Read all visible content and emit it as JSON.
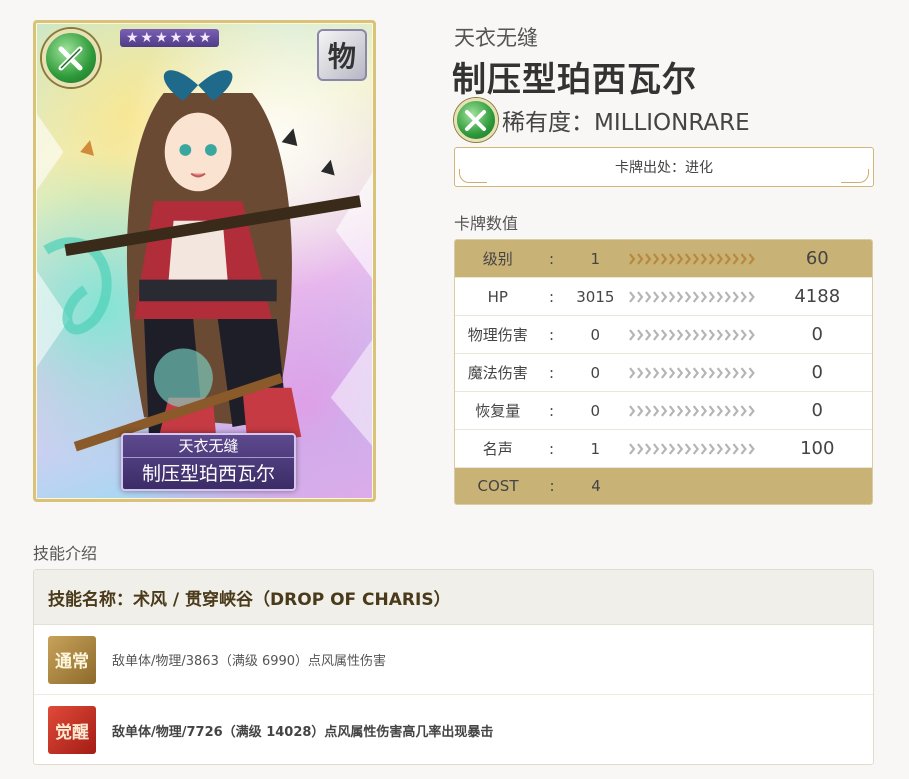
{
  "card": {
    "stars": "★★★★★★",
    "type_label": "物",
    "subtitle": "天衣无缝",
    "name": "制压型珀西瓦尔"
  },
  "header": {
    "subtitle": "天衣无缝",
    "title": "制压型珀西瓦尔",
    "rarity": "稀有度：MILLIONRARE",
    "source": "卡牌出处：进化"
  },
  "stats_label": "卡牌数值",
  "stats": [
    {
      "name": "级别",
      "colon": ":",
      "min": "1",
      "max": "60",
      "arrows": true
    },
    {
      "name": "HP",
      "colon": ":",
      "min": "3015",
      "max": "4188",
      "arrows": true
    },
    {
      "name": "物理伤害",
      "colon": ":",
      "min": "0",
      "max": "0",
      "arrows": true
    },
    {
      "name": "魔法伤害",
      "colon": ":",
      "min": "0",
      "max": "0",
      "arrows": true
    },
    {
      "name": "恢复量",
      "colon": ":",
      "min": "0",
      "max": "0",
      "arrows": true
    },
    {
      "name": "名声",
      "colon": ":",
      "min": "1",
      "max": "100",
      "arrows": true
    },
    {
      "name": "COST",
      "colon": ":",
      "min": "4",
      "max": "",
      "arrows": false
    }
  ],
  "skill_label": "技能介绍",
  "skill": {
    "title": "技能名称：术风 / 贯穿峡谷（DROP OF CHARIS）",
    "normal_badge": "通常",
    "normal_desc": "敌单体/物理/3863（满级 6990）点风属性伤害",
    "awake_badge": "觉醒",
    "awake_desc": "敌单体/物理/7726（满级 14028）点风属性伤害高几率出现暴击"
  },
  "colors": {
    "gold_row": "#c9b276",
    "arrow_gold": "#b8893a",
    "arrow_grey": "#b5b5b5",
    "rarity_green": "#2e9a3a"
  }
}
